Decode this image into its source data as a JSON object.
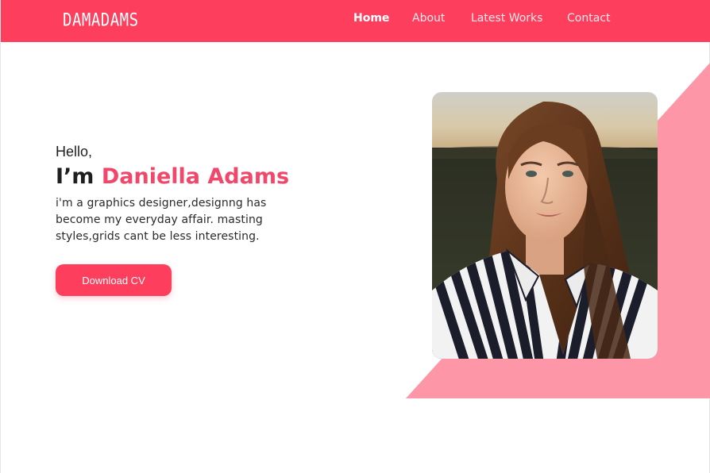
{
  "nav": {
    "logo": "DAMADAMS",
    "links": [
      {
        "label": "Home",
        "active": true
      },
      {
        "label": "About",
        "active": false
      },
      {
        "label": "Latest Works",
        "active": false
      },
      {
        "label": "Contact",
        "active": false
      }
    ]
  },
  "hero": {
    "greeting": "Hello,",
    "intro_prefix": "I’m ",
    "name": "Daniella Adams",
    "bio": "i'm a graphics designer,designng has become my everyday affair. masting styles,grids cant be less interesting.",
    "cta_label": "Download CV"
  },
  "colors": {
    "brand": "#fd3f5d",
    "accent_shape": "#fd97a7",
    "name_text": "#f0476a"
  }
}
